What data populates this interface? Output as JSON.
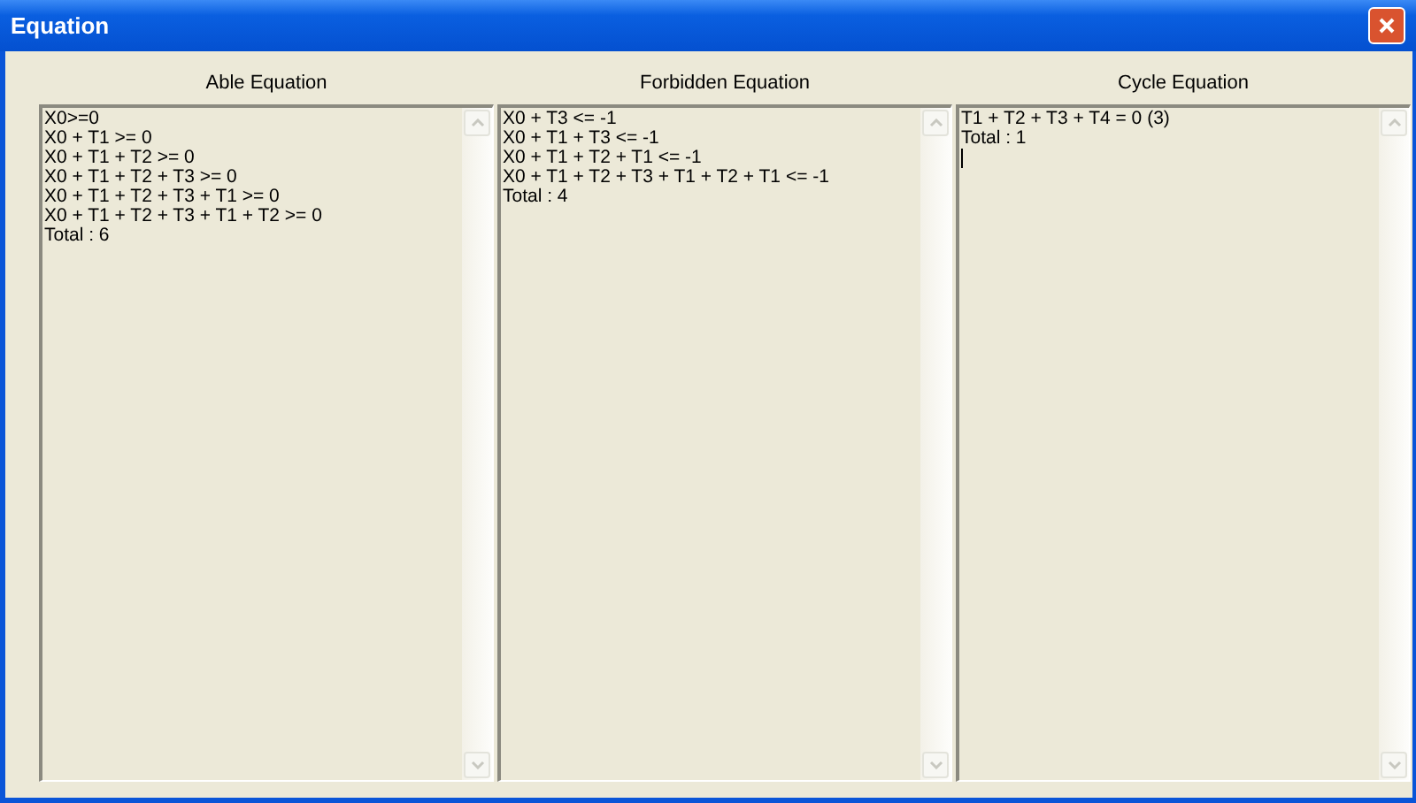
{
  "window": {
    "title": "Equation"
  },
  "panels": [
    {
      "heading": "Able Equation",
      "focused": false,
      "lines": [
        "X0>=0",
        "X0 + T1 >= 0",
        "X0 + T1 + T2 >= 0",
        "X0 + T1 + T2 + T3 >= 0",
        "X0 + T1 + T2 + T3 + T1 >= 0",
        "X0 + T1 + T2 + T3 + T1 + T2 >= 0",
        "Total : 6"
      ]
    },
    {
      "heading": "Forbidden Equation",
      "focused": false,
      "lines": [
        "X0 + T3 <= -1",
        "X0 + T1 + T3 <= -1",
        "X0 + T1 + T2 + T1 <= -1",
        "X0 + T1 + T2 + T3 + T1 + T2 + T1 <= -1",
        "Total : 4"
      ]
    },
    {
      "heading": "Cycle Equation",
      "focused": true,
      "lines": [
        "T1 + T2 + T3 + T4 = 0 (3)",
        "Total : 1"
      ]
    }
  ]
}
